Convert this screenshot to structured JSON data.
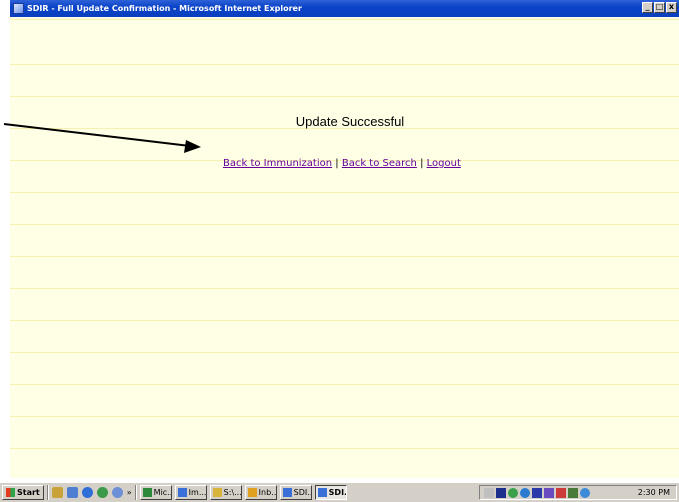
{
  "window": {
    "title": "SDIR - Full Update Confirmation - Microsoft Internet Explorer",
    "buttons": {
      "minimize": "_",
      "maximize": "□",
      "close": "x"
    }
  },
  "page": {
    "headline": "Update Successful",
    "links": {
      "immunization": "Back to Immunization",
      "search": "Back to Search",
      "logout": "Logout",
      "separator": "|"
    }
  },
  "taskbar": {
    "start_label": "Start",
    "chevron": "»",
    "tasks": [
      {
        "label": "Mic...",
        "icon": "app-icon"
      },
      {
        "label": "Im...",
        "icon": "document-icon"
      },
      {
        "label": "S:\\...",
        "icon": "folder-icon"
      },
      {
        "label": "Inb...",
        "icon": "mail-icon"
      },
      {
        "label": "SDI...",
        "icon": "ie-icon"
      },
      {
        "label": "SDI...",
        "icon": "ie-icon",
        "active": true
      }
    ],
    "clock": "2:30 PM"
  },
  "colors": {
    "page_background": "#ffffe6",
    "link": "#660099",
    "titlebar": "#0a46c8",
    "taskbar": "#d4d0c8"
  }
}
